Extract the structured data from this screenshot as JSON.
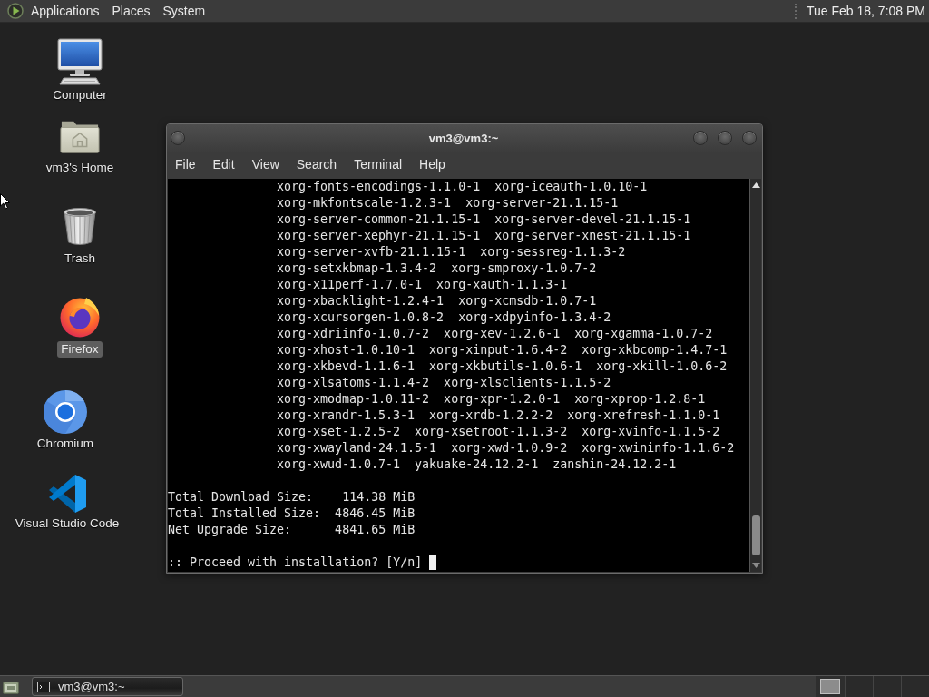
{
  "top_panel": {
    "menus": [
      "Applications",
      "Places",
      "System"
    ],
    "clock": "Tue Feb 18, 7:08 PM"
  },
  "desktop": {
    "icons": [
      {
        "kind": "computer",
        "label": "Computer",
        "selected": false
      },
      {
        "kind": "home",
        "label": "vm3's Home",
        "selected": false
      },
      {
        "kind": "trash",
        "label": "Trash",
        "selected": false
      },
      {
        "kind": "firefox",
        "label": "Firefox",
        "selected": true
      },
      {
        "kind": "chromium",
        "label": "Chromium",
        "selected": false
      },
      {
        "kind": "vscode",
        "label": "Visual Studio Code",
        "selected": false
      }
    ]
  },
  "terminal_window": {
    "title": "vm3@vm3:~",
    "menu": [
      "File",
      "Edit",
      "View",
      "Search",
      "Terminal",
      "Help"
    ],
    "package_lines": [
      "xorg-fonts-encodings-1.1.0-1  xorg-iceauth-1.0.10-1",
      "xorg-mkfontscale-1.2.3-1  xorg-server-21.1.15-1",
      "xorg-server-common-21.1.15-1  xorg-server-devel-21.1.15-1",
      "xorg-server-xephyr-21.1.15-1  xorg-server-xnest-21.1.15-1",
      "xorg-server-xvfb-21.1.15-1  xorg-sessreg-1.1.3-2",
      "xorg-setxkbmap-1.3.4-2  xorg-smproxy-1.0.7-2",
      "xorg-x11perf-1.7.0-1  xorg-xauth-1.1.3-1",
      "xorg-xbacklight-1.2.4-1  xorg-xcmsdb-1.0.7-1",
      "xorg-xcursorgen-1.0.8-2  xorg-xdpyinfo-1.3.4-2",
      "xorg-xdriinfo-1.0.7-2  xorg-xev-1.2.6-1  xorg-xgamma-1.0.7-2",
      "xorg-xhost-1.0.10-1  xorg-xinput-1.6.4-2  xorg-xkbcomp-1.4.7-1",
      "xorg-xkbevd-1.1.6-1  xorg-xkbutils-1.0.6-1  xorg-xkill-1.0.6-2",
      "xorg-xlsatoms-1.1.4-2  xorg-xlsclients-1.1.5-2",
      "xorg-xmodmap-1.0.11-2  xorg-xpr-1.2.0-1  xorg-xprop-1.2.8-1",
      "xorg-xrandr-1.5.3-1  xorg-xrdb-1.2.2-2  xorg-xrefresh-1.1.0-1",
      "xorg-xset-1.2.5-2  xorg-xsetroot-1.1.3-2  xorg-xvinfo-1.1.5-2",
      "xorg-xwayland-24.1.5-1  xorg-xwd-1.0.9-2  xorg-xwininfo-1.1.6-2",
      "xorg-xwud-1.0.7-1  yakuake-24.12.2-1  zanshin-24.12.2-1"
    ],
    "summary_lines": [
      "Total Download Size:    114.38 MiB",
      "Total Installed Size:  4846.45 MiB",
      "Net Upgrade Size:      4841.65 MiB"
    ],
    "prompt": ":: Proceed with installation? [Y/n]"
  },
  "bottom_panel": {
    "tasks": [
      "vm3@vm3:~"
    ],
    "workspaces": [
      {
        "selected": true
      },
      {
        "selected": false
      },
      {
        "selected": false
      },
      {
        "selected": false
      }
    ]
  }
}
